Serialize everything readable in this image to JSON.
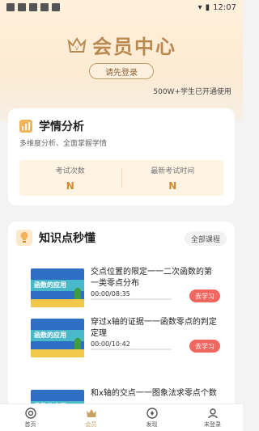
{
  "status_bar": {
    "time": "12:07"
  },
  "header": {
    "title": "会员中心",
    "login_button": "请先登录",
    "usage_note": "500W+学生已开通使用"
  },
  "analysis": {
    "title": "学情分析",
    "subtitle": "多维度分析、全面掌握学情",
    "stats": [
      {
        "label": "考试次数",
        "value": "N"
      },
      {
        "label": "最新考试时间",
        "value": "N"
      }
    ]
  },
  "knowledge": {
    "title": "知识点秒懂",
    "all_courses_button": "全部课程",
    "thumbnail_text": "函数的应用",
    "study_button": "去学习",
    "courses": [
      {
        "title": "交点位置的限定一一二次函数的第一类零点分布",
        "time": "00:00/08:35"
      },
      {
        "title": "穿过x轴的证据一一函数零点的判定定理",
        "time": "00:00/10:42"
      },
      {
        "title": "和x轴的交点一一图象法求零点个数",
        "time": ""
      }
    ]
  },
  "tabbar": {
    "items": [
      {
        "label": "首页",
        "icon": "home-icon"
      },
      {
        "label": "会员",
        "icon": "crown-icon"
      },
      {
        "label": "发现",
        "icon": "discover-icon"
      },
      {
        "label": "未登录",
        "icon": "user-icon"
      }
    ],
    "active_index": 1
  },
  "colors": {
    "gold": "#b88950",
    "accent_orange": "#d48a2c",
    "study_red": "#f0675f"
  }
}
